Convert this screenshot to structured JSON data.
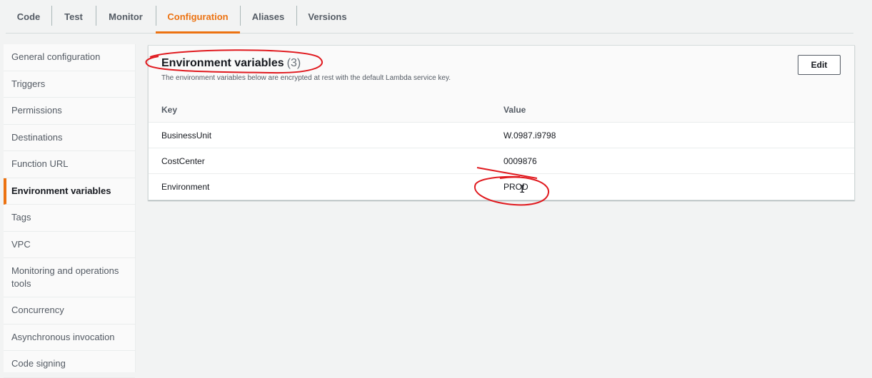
{
  "tabs": [
    {
      "label": "Code"
    },
    {
      "label": "Test"
    },
    {
      "label": "Monitor"
    },
    {
      "label": "Configuration",
      "active": true
    },
    {
      "label": "Aliases"
    },
    {
      "label": "Versions"
    }
  ],
  "sidenav": {
    "items": [
      {
        "label": "General configuration"
      },
      {
        "label": "Triggers"
      },
      {
        "label": "Permissions"
      },
      {
        "label": "Destinations"
      },
      {
        "label": "Function URL"
      },
      {
        "label": "Environment variables",
        "active": true
      },
      {
        "label": "Tags"
      },
      {
        "label": "VPC"
      },
      {
        "label": "Monitoring and operations tools"
      },
      {
        "label": "Concurrency"
      },
      {
        "label": "Asynchronous invocation"
      },
      {
        "label": "Code signing"
      }
    ]
  },
  "panel": {
    "title": "Environment variables",
    "count": "(3)",
    "description": "The environment variables below are encrypted at rest with the default Lambda service key.",
    "edit_label": "Edit",
    "columns": {
      "key": "Key",
      "value": "Value"
    },
    "rows": [
      {
        "key": "BusinessUnit",
        "value": "W.0987.i9798"
      },
      {
        "key": "CostCenter",
        "value": "0009876"
      },
      {
        "key": "Environment",
        "value": "PROD"
      }
    ]
  },
  "colors": {
    "accent": "#ec7211",
    "annotation": "#e0191e"
  },
  "cursor": {
    "icon": "text-cursor-icon"
  }
}
